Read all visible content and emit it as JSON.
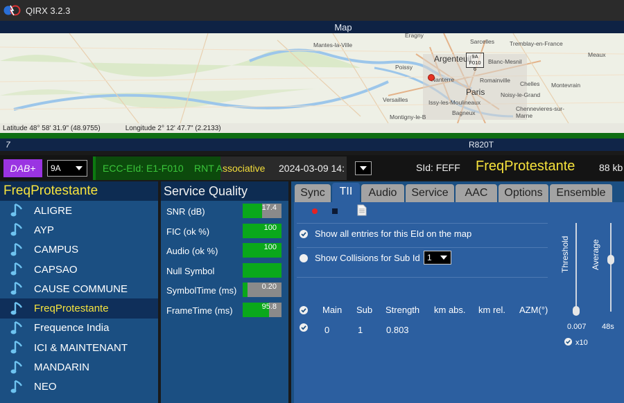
{
  "window": {
    "title": "QIRX 3.2.3"
  },
  "map": {
    "title": "Map",
    "places": [
      "Mantes-la-Ville",
      "Poissy",
      "Argenteuil",
      "Sarcelles",
      "Tremblay-en-France",
      "Meaux",
      "Blanc-Mesnil",
      "Nanterre",
      "Romainville",
      "Chelles",
      "Paris",
      "Noisy-le-Grand",
      "Montevrain",
      "Versailles",
      "Issy-les-Moulineaux",
      "Bagneux",
      "Chennevieres-sur-Marne",
      "Montigny-le-B",
      "Eragny"
    ],
    "tower_label": "9A\nF010\n6",
    "latitude": "Latitude  48° 58' 31.9\" (48.9755)",
    "longitude": "Longitude  2° 12' 47.7\" (2.2133)"
  },
  "status_strip": {
    "index": "7",
    "tuner": "R820T"
  },
  "info": {
    "mode": "DAB+",
    "channel": "9A",
    "ecc_eid": "ECC-EId: E1-F010",
    "pty_head": "RNT A",
    "pty_tail": "ssociative",
    "datetime": "2024-03-09  14:",
    "sid": "SId: FEFF",
    "station": "FreqProtestante",
    "bitrate": "88 kb"
  },
  "station_list": {
    "title": "FreqProtestante",
    "items": [
      "ALIGRE",
      "AYP",
      "CAMPUS",
      "CAPSAO",
      "CAUSE COMMUNE",
      "FreqProtestante",
      "Frequence India",
      "ICI & MAINTENANT",
      "MANDARIN",
      "NEO"
    ],
    "active": "FreqProtestante"
  },
  "service_quality": {
    "title": "Service Quality",
    "rows": [
      {
        "label": "SNR (dB)",
        "value": "17.4",
        "fill": 0.5
      },
      {
        "label": "FIC (ok %)",
        "value": "100",
        "fill": 1.0
      },
      {
        "label": "Audio (ok %)",
        "value": "100",
        "fill": 1.0
      },
      {
        "label": "Null Symbol",
        "value": "",
        "fill": 1.0
      },
      {
        "label": "SymbolTime (ms)",
        "value": "0.20",
        "fill": 0.12
      },
      {
        "label": "FrameTime (ms)",
        "value": "95.8",
        "fill": 0.68
      }
    ]
  },
  "tabs": [
    "Sync",
    "TII",
    "Audio",
    "Service",
    "AAC",
    "Options",
    "Ensemble"
  ],
  "active_tab": "TII",
  "tii": {
    "show_all_label": "Show all entries for this EId on the map",
    "show_collisions_label": "Show Collisions for Sub Id",
    "sub_id": "1",
    "columns": [
      "Main",
      "Sub",
      "Strength",
      "km abs.",
      "km rel.",
      "AZM(°)"
    ],
    "rows": [
      {
        "main": "0",
        "sub": "1",
        "strength": "0.803"
      }
    ],
    "threshold_label": "Threshold",
    "average_label": "Average",
    "threshold_value": "0.007",
    "average_value": "48s",
    "x10_label": "x10"
  },
  "colors": {
    "accent_yellow": "#f7e33e",
    "panel_blue": "#1b4f82",
    "header_navy": "#0d2c52",
    "quality_green": "#0aa81b",
    "dab_purple": "#9a34e2"
  }
}
